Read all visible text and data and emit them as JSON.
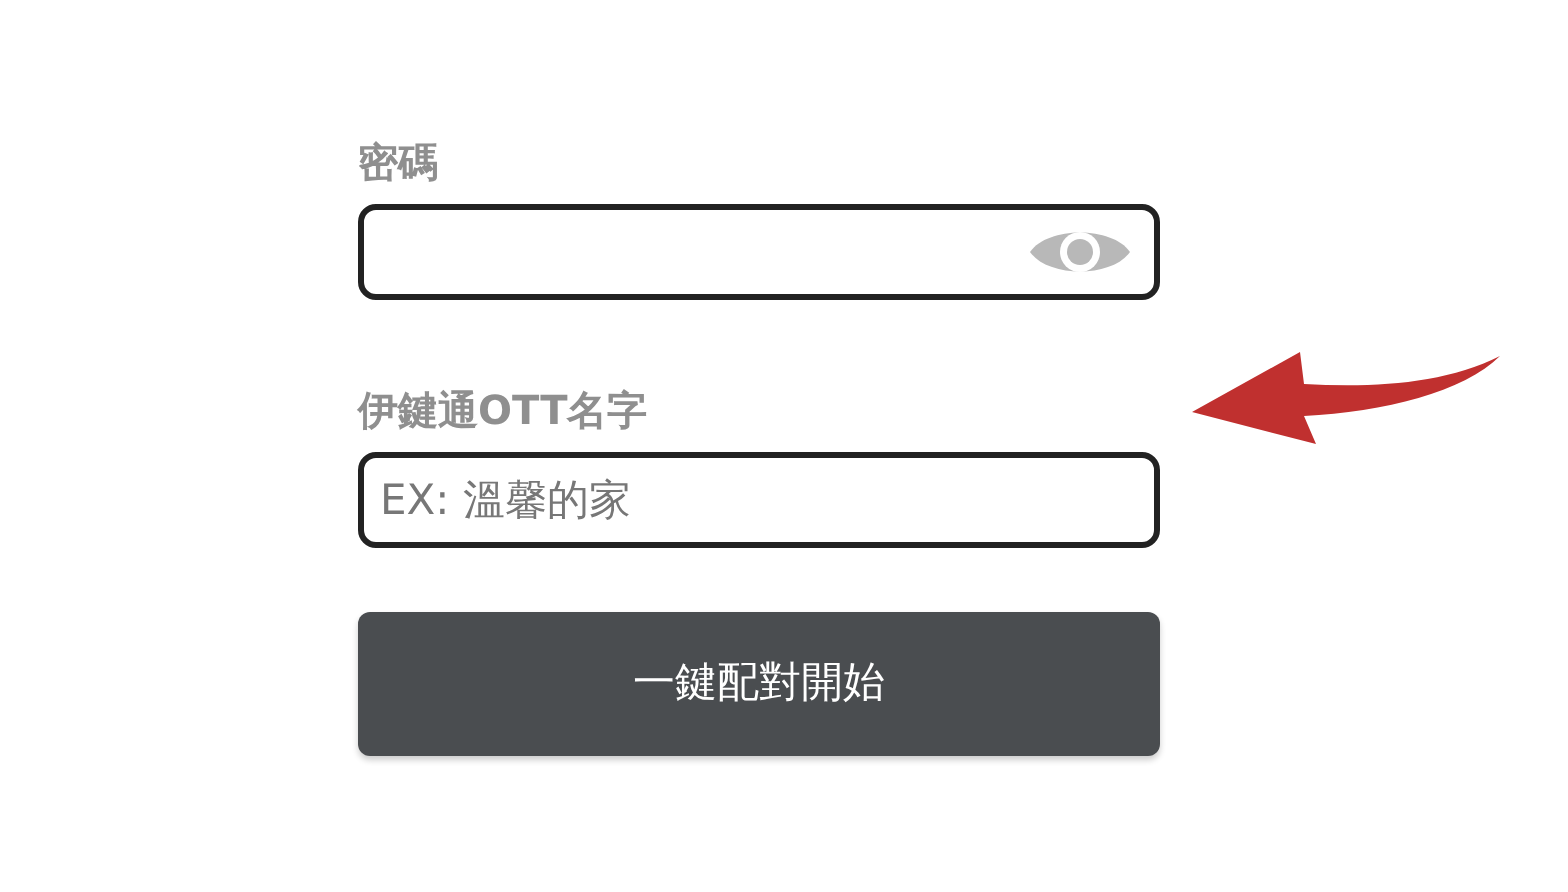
{
  "fields": [
    {
      "kind": "password",
      "label": "密碼"
    },
    {
      "kind": "text",
      "label": "伊鍵通OTT名字",
      "placeholder": "EX: 溫馨的家"
    }
  ],
  "button": {
    "label": "一鍵配對開始"
  }
}
